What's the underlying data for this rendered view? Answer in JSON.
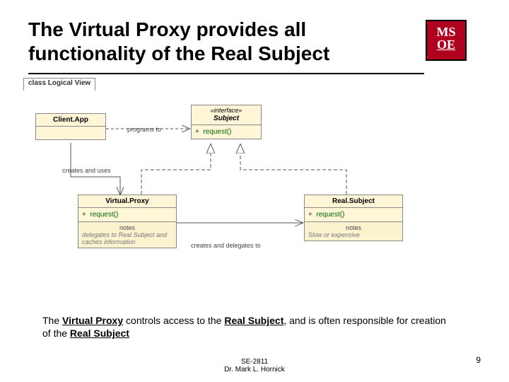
{
  "title": "The Virtual Proxy provides all functionality of the Real Subject",
  "logo": {
    "line1": "MS",
    "line2": "OE"
  },
  "frame_label": "class Logical View",
  "client": {
    "name": "Client.App"
  },
  "subject": {
    "stereotype": "«interface»",
    "name": "Subject",
    "op_vis": "+",
    "op": "request()"
  },
  "virtual_proxy": {
    "name": "Virtual.Proxy",
    "op_vis": "+",
    "op": "request()",
    "note_head": "notes",
    "note_body": "delegates to Real Subject and caches information"
  },
  "real_subject": {
    "name": "Real.Subject",
    "op_vis": "+",
    "op": "request()",
    "note_head": "notes",
    "note_body": "Slow or expensive"
  },
  "edges": {
    "programs_to": "programs to",
    "creates_and_uses": "creates and uses",
    "creates_and_delegates_to": "creates and delegates to"
  },
  "bottom_parts": {
    "p1": "The ",
    "vp": "Virtual Proxy",
    "p2": " controls access to the ",
    "rs1": "Real Subject",
    "p3": ", and is often responsible for creation of the ",
    "rs2": "Real Subject"
  },
  "footer": {
    "course": "SE-2811",
    "author": "Dr. Mark L. Hornick"
  },
  "page_number": "9"
}
